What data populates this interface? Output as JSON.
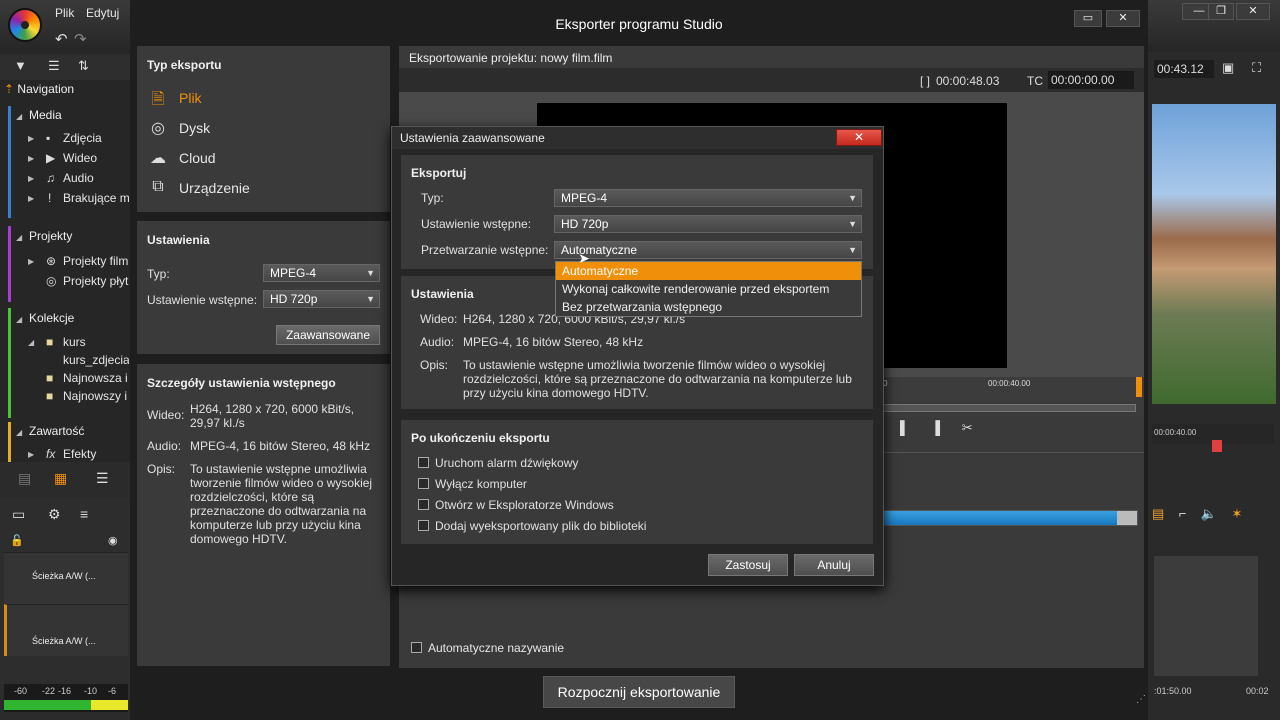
{
  "app": {
    "menu": [
      "Plik",
      "Edytuj"
    ],
    "window_title": "Eksporter programu Studio"
  },
  "left_panel": {
    "navigation": "Navigation",
    "media": {
      "header": "Media",
      "items": [
        "Zdjęcia",
        "Wideo",
        "Audio",
        "Brakujące m"
      ]
    },
    "projekty": {
      "header": "Projekty",
      "items": [
        "Projekty film",
        "Projekty płyt"
      ]
    },
    "kolekcje": {
      "header": "Kolekcje",
      "items": [
        "kurs",
        "kurs_zdjecia",
        "Najnowsza i",
        "Najnowszy i"
      ]
    },
    "zawartosc": {
      "header": "Zawartość",
      "items": [
        "Efekty"
      ]
    },
    "tracks": [
      "Ścieżka A/W (...",
      "Ścieżka A/W (..."
    ],
    "meter_labels": [
      "-60",
      "-22",
      "-16",
      "-10",
      "-6"
    ]
  },
  "export_type": {
    "header": "Typ eksportu",
    "items": [
      {
        "label": "Plik",
        "icon": "file-export-icon",
        "active": true
      },
      {
        "label": "Dysk",
        "icon": "disc-icon",
        "active": false
      },
      {
        "label": "Cloud",
        "icon": "cloud-icon",
        "active": false
      },
      {
        "label": "Urządzenie",
        "icon": "device-icon",
        "active": false
      }
    ]
  },
  "settings": {
    "header": "Ustawienia",
    "type_label": "Typ:",
    "type_value": "MPEG-4",
    "preset_label": "Ustawienie wstępne:",
    "preset_value": "HD 720p",
    "advanced_button": "Zaawansowane"
  },
  "preset_details": {
    "header": "Szczegóły ustawienia wstępnego",
    "video_label": "Wideo:",
    "video_value": "H264, 1280 x 720, 6000 kBit/s, 29,97 kl./s",
    "audio_label": "Audio:",
    "audio_value": "MPEG-4, 16 bitów Stereo, 48 kHz",
    "desc_label": "Opis:",
    "desc_value": "To ustawienie wstępne umożliwia tworzenie filmów wideo o wysokiej rozdzielczości, które są przeznaczone do odtwarzania na komputerze lub przy użyciu kina domowego HDTV."
  },
  "preview": {
    "title": "Eksportowanie projektu: nowy film.film",
    "duration_label": "[ ]",
    "duration": "00:00:48.03",
    "tc_label": "TC",
    "tc_value": "00:00:00.00",
    "scrub_time": "00:00:40.00",
    "scrub_start": "0",
    "auto_naming": "Automatyczne nazywanie",
    "start_button": "Rozpocznij eksportowanie"
  },
  "right_panel": {
    "time": "00:43.12",
    "ruler_time": "00:00:40.00",
    "foot_time_1": ":01:50.00",
    "foot_time_2": "00:02"
  },
  "advanced_dialog": {
    "title": "Ustawienia zaawansowane",
    "close": "✕",
    "export_header": "Eksportuj",
    "type_label": "Typ:",
    "type_value": "MPEG-4",
    "preset_label": "Ustawienie wstępne:",
    "preset_value": "HD 720p",
    "preprocess_label": "Przetwarzanie wstępne:",
    "preprocess_value": "Automatyczne",
    "preprocess_options": [
      "Automatyczne",
      "Wykonaj całkowite renderowanie przed eksportem",
      "Bez przetwarzania wstępnego"
    ],
    "settings_header": "Ustawienia",
    "video_label": "Wideo:",
    "video_value": "H264, 1280 x 720, 6000 kBit/s, 29,97 kl./s",
    "audio_label": "Audio:",
    "audio_value": "MPEG-4, 16 bitów Stereo, 48 kHz",
    "desc_label": "Opis:",
    "desc_value": "To ustawienie wstępne umożliwia tworzenie filmów wideo o wysokiej rozdzielczości, które są przeznaczone do odtwarzania na komputerze lub przy użyciu kina domowego HDTV.",
    "after_header": "Po ukończeniu eksportu",
    "after_options": [
      "Uruchom alarm dźwiękowy",
      "Wyłącz komputer",
      "Otwórz w Eksploratorze Windows",
      "Dodaj wyeksportowany plik do biblioteki"
    ],
    "apply_button": "Zastosuj",
    "cancel_button": "Anuluj"
  },
  "colors": {
    "accent": "#f0900a",
    "progress": "#1e88d8",
    "close_red": "#d6392c"
  }
}
